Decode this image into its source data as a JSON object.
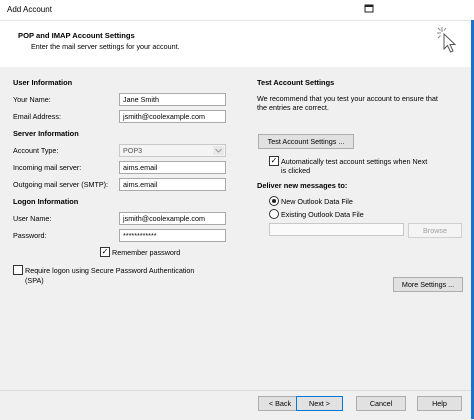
{
  "window": {
    "title": "Add Account"
  },
  "header": {
    "title": "POP and IMAP Account Settings",
    "subtitle": "Enter the mail server settings for your account."
  },
  "user_info": {
    "section": "User Information",
    "name_label": "Your Name:",
    "name_value": "Jane Smith",
    "email_label": "Email Address:",
    "email_value": "jsmith@coolexample.com"
  },
  "server_info": {
    "section": "Server Information",
    "type_label": "Account Type:",
    "type_value": "POP3",
    "incoming_label": "Incoming mail server:",
    "incoming_value": "aims.email",
    "outgoing_label": "Outgoing mail server (SMTP):",
    "outgoing_value": "aims.email"
  },
  "logon_info": {
    "section": "Logon Information",
    "user_label": "User Name:",
    "user_value": "jsmith@coolexample.com",
    "password_label": "Password:",
    "password_value": "************",
    "remember_label": "Remember password",
    "remember_checked": true,
    "spa_label_1": "Require logon using Secure Password Authentication",
    "spa_label_2": "(SPA)",
    "spa_checked": false
  },
  "test_settings": {
    "section": "Test Account Settings",
    "desc_1": "We recommend that you test your account to ensure that",
    "desc_2": "the entries are correct.",
    "test_button": "Test Account Settings ...",
    "auto_test_1": "Automatically test account settings when Next",
    "auto_test_2": "is clicked",
    "auto_test_checked": true
  },
  "deliver": {
    "section": "Deliver new messages to:",
    "option_new": "New Outlook Data File",
    "option_existing": "Existing Outlook Data File",
    "selected": "new",
    "browse_button": "Browse",
    "existing_path": ""
  },
  "more_settings_button": "More Settings ...",
  "footer": {
    "back": "< Back",
    "next": "Next >",
    "cancel": "Cancel",
    "help": "Help"
  }
}
